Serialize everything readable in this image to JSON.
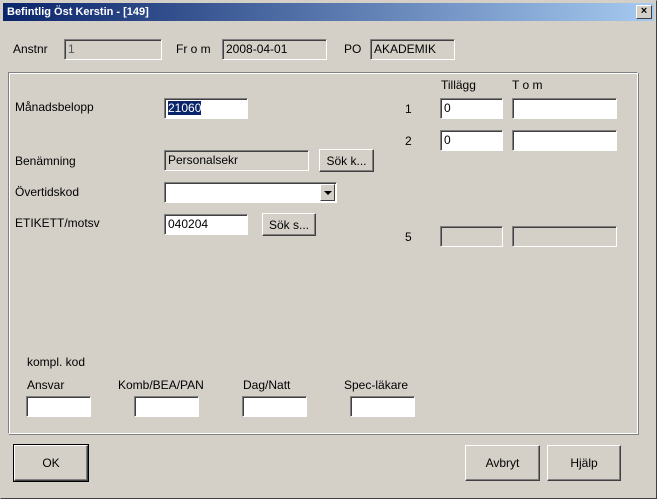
{
  "window": {
    "title": "Befintlig Öst Kerstin - [149]",
    "close_glyph": "×"
  },
  "header": {
    "anstnr_label": "Anstnr",
    "anstnr_value": "1",
    "from_label": "Fr o m",
    "from_value": "2008-04-01",
    "po_label": "PO",
    "po_value": "AKADEMIK"
  },
  "form": {
    "manadsbelopp_label": "Månadsbelopp",
    "manadsbelopp_value": "21060",
    "benamning_label": "Benämning",
    "benamning_value": "Personalsekr",
    "sok_k_label": "Sök k...",
    "overtidskod_label": "Övertidskod",
    "overtidskod_value": "",
    "etikett_label": "ETIKETT/motsv",
    "etikett_value": "040204",
    "sok_s_label": "Sök s..."
  },
  "tillagg": {
    "col_tillagg": "Tillägg",
    "col_tom": "T o m",
    "rows": [
      {
        "num": "1",
        "tillagg": "0",
        "tom": ""
      },
      {
        "num": "2",
        "tillagg": "0",
        "tom": ""
      },
      {
        "num": "5",
        "tillagg": "",
        "tom": ""
      }
    ]
  },
  "kompl": {
    "heading": "kompl. kod",
    "ansvar_label": "Ansvar",
    "komb_label": "Komb/BEA/PAN",
    "dag_label": "Dag/Natt",
    "spec_label": "Spec-läkare"
  },
  "buttons": {
    "ok": "OK",
    "avbryt": "Avbryt",
    "hjalp": "Hjälp"
  }
}
